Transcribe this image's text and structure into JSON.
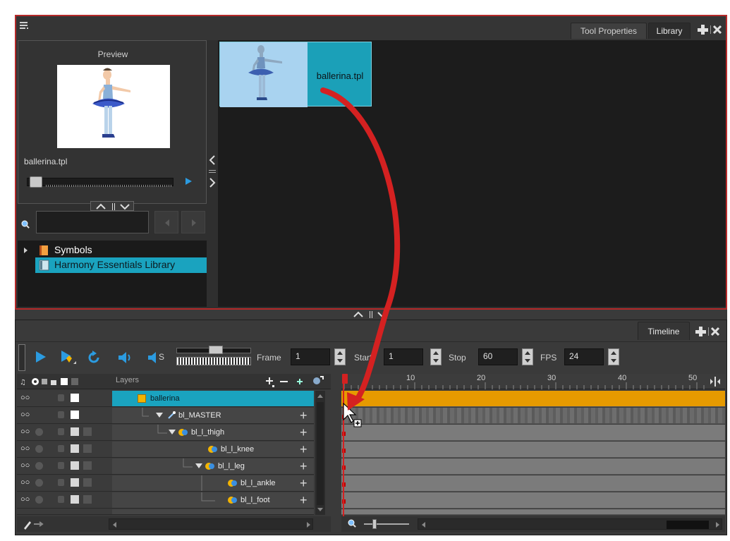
{
  "library_panel": {
    "tabs": [
      {
        "label": "Tool Properties"
      },
      {
        "label": "Library"
      }
    ],
    "preview": {
      "title": "Preview",
      "file_name": "ballerina.tpl"
    },
    "thumbnail": {
      "label": "ballerina.tpl"
    },
    "tree": {
      "items": [
        {
          "label": "Symbols"
        },
        {
          "label": "Harmony Essentials Library"
        }
      ]
    }
  },
  "timeline_panel": {
    "tab": {
      "label": "Timeline"
    },
    "toolbar": {
      "frame_label": "Frame",
      "frame_value": "1",
      "start_label": "Start",
      "start_value": "1",
      "stop_label": "Stop",
      "stop_value": "60",
      "fps_label": "FPS",
      "fps_value": "24",
      "mute_label": "S"
    },
    "layers_header": "Layers",
    "ruler_ticks": [
      "10",
      "20",
      "30",
      "40",
      "50"
    ],
    "layers": [
      {
        "name": "ballerina",
        "depth": 0
      },
      {
        "name": "bl_MASTER",
        "depth": 1
      },
      {
        "name": "bl_l_thigh",
        "depth": 2
      },
      {
        "name": "bl_l_knee",
        "depth": 3
      },
      {
        "name": "bl_l_leg",
        "depth": 3
      },
      {
        "name": "bl_l_ankle",
        "depth": 4
      },
      {
        "name": "bl_l_foot",
        "depth": 4
      }
    ]
  },
  "colors": {
    "panel_border": "#b52a2a",
    "selection": "#1aa3bf",
    "accent_blue": "#2b9be0",
    "timeline_orange": "#e69a00",
    "arrow_red": "#d42121"
  }
}
